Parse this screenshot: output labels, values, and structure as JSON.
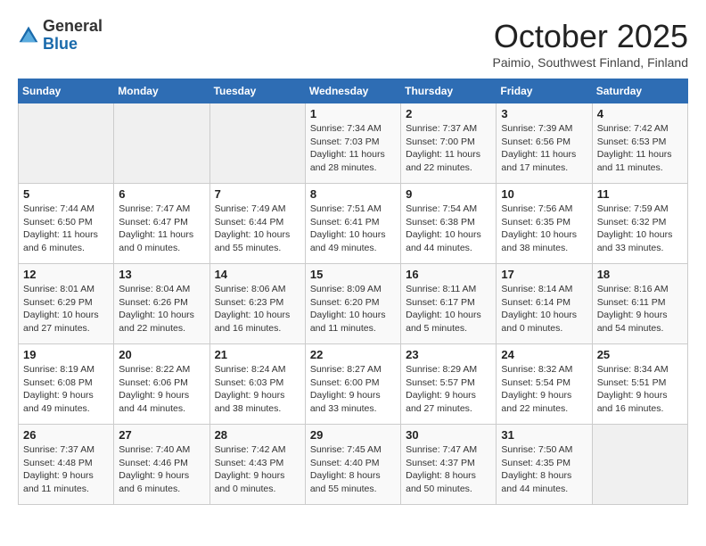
{
  "header": {
    "logo_general": "General",
    "logo_blue": "Blue",
    "month": "October 2025",
    "location": "Paimio, Southwest Finland, Finland"
  },
  "days_of_week": [
    "Sunday",
    "Monday",
    "Tuesday",
    "Wednesday",
    "Thursday",
    "Friday",
    "Saturday"
  ],
  "weeks": [
    [
      {
        "day": "",
        "info": ""
      },
      {
        "day": "",
        "info": ""
      },
      {
        "day": "",
        "info": ""
      },
      {
        "day": "1",
        "info": "Sunrise: 7:34 AM\nSunset: 7:03 PM\nDaylight: 11 hours and 28 minutes."
      },
      {
        "day": "2",
        "info": "Sunrise: 7:37 AM\nSunset: 7:00 PM\nDaylight: 11 hours and 22 minutes."
      },
      {
        "day": "3",
        "info": "Sunrise: 7:39 AM\nSunset: 6:56 PM\nDaylight: 11 hours and 17 minutes."
      },
      {
        "day": "4",
        "info": "Sunrise: 7:42 AM\nSunset: 6:53 PM\nDaylight: 11 hours and 11 minutes."
      }
    ],
    [
      {
        "day": "5",
        "info": "Sunrise: 7:44 AM\nSunset: 6:50 PM\nDaylight: 11 hours and 6 minutes."
      },
      {
        "day": "6",
        "info": "Sunrise: 7:47 AM\nSunset: 6:47 PM\nDaylight: 11 hours and 0 minutes."
      },
      {
        "day": "7",
        "info": "Sunrise: 7:49 AM\nSunset: 6:44 PM\nDaylight: 10 hours and 55 minutes."
      },
      {
        "day": "8",
        "info": "Sunrise: 7:51 AM\nSunset: 6:41 PM\nDaylight: 10 hours and 49 minutes."
      },
      {
        "day": "9",
        "info": "Sunrise: 7:54 AM\nSunset: 6:38 PM\nDaylight: 10 hours and 44 minutes."
      },
      {
        "day": "10",
        "info": "Sunrise: 7:56 AM\nSunset: 6:35 PM\nDaylight: 10 hours and 38 minutes."
      },
      {
        "day": "11",
        "info": "Sunrise: 7:59 AM\nSunset: 6:32 PM\nDaylight: 10 hours and 33 minutes."
      }
    ],
    [
      {
        "day": "12",
        "info": "Sunrise: 8:01 AM\nSunset: 6:29 PM\nDaylight: 10 hours and 27 minutes."
      },
      {
        "day": "13",
        "info": "Sunrise: 8:04 AM\nSunset: 6:26 PM\nDaylight: 10 hours and 22 minutes."
      },
      {
        "day": "14",
        "info": "Sunrise: 8:06 AM\nSunset: 6:23 PM\nDaylight: 10 hours and 16 minutes."
      },
      {
        "day": "15",
        "info": "Sunrise: 8:09 AM\nSunset: 6:20 PM\nDaylight: 10 hours and 11 minutes."
      },
      {
        "day": "16",
        "info": "Sunrise: 8:11 AM\nSunset: 6:17 PM\nDaylight: 10 hours and 5 minutes."
      },
      {
        "day": "17",
        "info": "Sunrise: 8:14 AM\nSunset: 6:14 PM\nDaylight: 10 hours and 0 minutes."
      },
      {
        "day": "18",
        "info": "Sunrise: 8:16 AM\nSunset: 6:11 PM\nDaylight: 9 hours and 54 minutes."
      }
    ],
    [
      {
        "day": "19",
        "info": "Sunrise: 8:19 AM\nSunset: 6:08 PM\nDaylight: 9 hours and 49 minutes."
      },
      {
        "day": "20",
        "info": "Sunrise: 8:22 AM\nSunset: 6:06 PM\nDaylight: 9 hours and 44 minutes."
      },
      {
        "day": "21",
        "info": "Sunrise: 8:24 AM\nSunset: 6:03 PM\nDaylight: 9 hours and 38 minutes."
      },
      {
        "day": "22",
        "info": "Sunrise: 8:27 AM\nSunset: 6:00 PM\nDaylight: 9 hours and 33 minutes."
      },
      {
        "day": "23",
        "info": "Sunrise: 8:29 AM\nSunset: 5:57 PM\nDaylight: 9 hours and 27 minutes."
      },
      {
        "day": "24",
        "info": "Sunrise: 8:32 AM\nSunset: 5:54 PM\nDaylight: 9 hours and 22 minutes."
      },
      {
        "day": "25",
        "info": "Sunrise: 8:34 AM\nSunset: 5:51 PM\nDaylight: 9 hours and 16 minutes."
      }
    ],
    [
      {
        "day": "26",
        "info": "Sunrise: 7:37 AM\nSunset: 4:48 PM\nDaylight: 9 hours and 11 minutes."
      },
      {
        "day": "27",
        "info": "Sunrise: 7:40 AM\nSunset: 4:46 PM\nDaylight: 9 hours and 6 minutes."
      },
      {
        "day": "28",
        "info": "Sunrise: 7:42 AM\nSunset: 4:43 PM\nDaylight: 9 hours and 0 minutes."
      },
      {
        "day": "29",
        "info": "Sunrise: 7:45 AM\nSunset: 4:40 PM\nDaylight: 8 hours and 55 minutes."
      },
      {
        "day": "30",
        "info": "Sunrise: 7:47 AM\nSunset: 4:37 PM\nDaylight: 8 hours and 50 minutes."
      },
      {
        "day": "31",
        "info": "Sunrise: 7:50 AM\nSunset: 4:35 PM\nDaylight: 8 hours and 44 minutes."
      },
      {
        "day": "",
        "info": ""
      }
    ]
  ]
}
